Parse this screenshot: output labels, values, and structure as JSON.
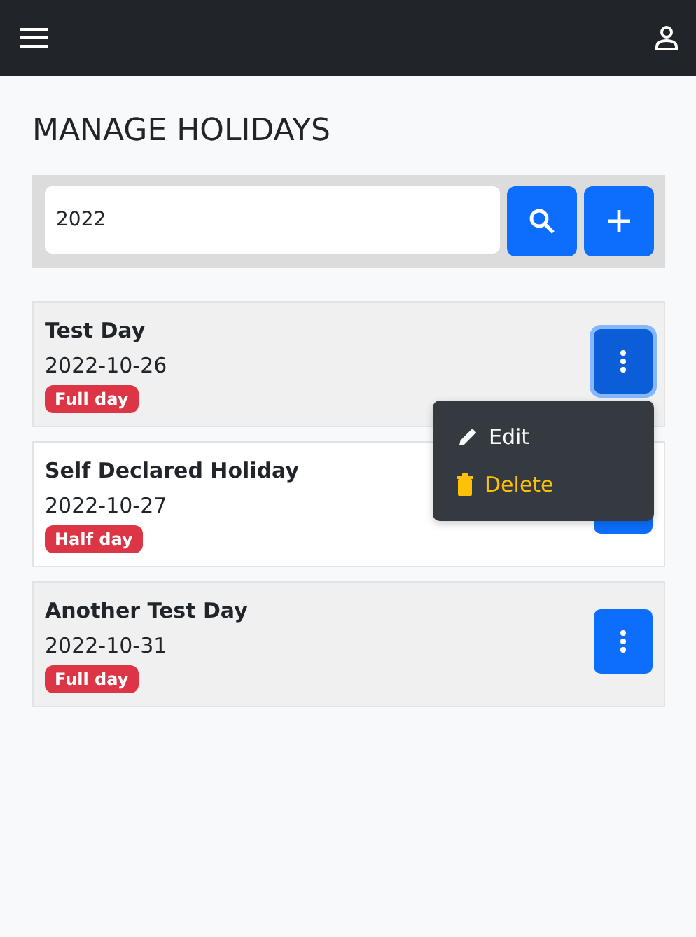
{
  "page": {
    "title": "MANAGE HOLIDAYS"
  },
  "search": {
    "value": "2022"
  },
  "holidays": [
    {
      "name": "Test Day",
      "date": "2022-10-26",
      "badge": "Full day",
      "expanded": true
    },
    {
      "name": "Self Declared Holiday",
      "date": "2022-10-27",
      "badge": "Half day",
      "expanded": false
    },
    {
      "name": "Another Test Day",
      "date": "2022-10-31",
      "badge": "Full day",
      "expanded": false
    }
  ],
  "menu": [
    {
      "kind": "edit",
      "label": "Edit"
    },
    {
      "kind": "delete",
      "label": "Delete"
    }
  ]
}
